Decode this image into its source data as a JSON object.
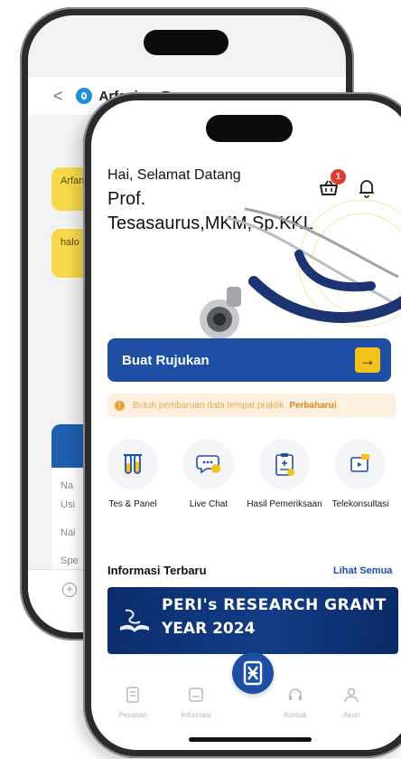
{
  "back_screen": {
    "chat_header": {
      "back_symbol": "<",
      "contact_name": "Arfanizar F"
    },
    "bubbles": [
      {
        "text": "Arfan dalam"
      },
      {
        "text": "halo"
      }
    ],
    "card_lines": [
      "Na",
      "Usi",
      "Nai",
      "Spe"
    ]
  },
  "front_screen": {
    "greeting": "Hai, Selamat Datang",
    "doctor_name": "Prof. Tesasaurus,MKM,Sp.KKL",
    "cart_badge": "1",
    "primary_button": {
      "label": "Buat Rujukan",
      "arrow": "→"
    },
    "notice": {
      "text": "Butuh pembaruan data tempat praktik",
      "link": "Perbaharui"
    },
    "menu": [
      {
        "label": "Tes & Panel"
      },
      {
        "label": "Live Chat"
      },
      {
        "label": "Hasil Pemeriksaan"
      },
      {
        "label": "Telekonsultasi"
      }
    ],
    "info_section": {
      "title": "Informasi Terbaru",
      "see_all": "Lihat Semua",
      "banner_line1": "PERI's RESEARCH GRANT",
      "banner_line2": "YEAR 2024"
    },
    "bottom_nav": [
      {
        "label": "Pesanan"
      },
      {
        "label": "Informasi"
      },
      {
        "label": "Kontak"
      },
      {
        "label": "Akun"
      }
    ]
  },
  "colors": {
    "brand_blue": "#1f4ea5",
    "accent_yellow": "#f5c21a",
    "badge_red": "#e33a2f",
    "notice_orange": "#e9a23a"
  }
}
